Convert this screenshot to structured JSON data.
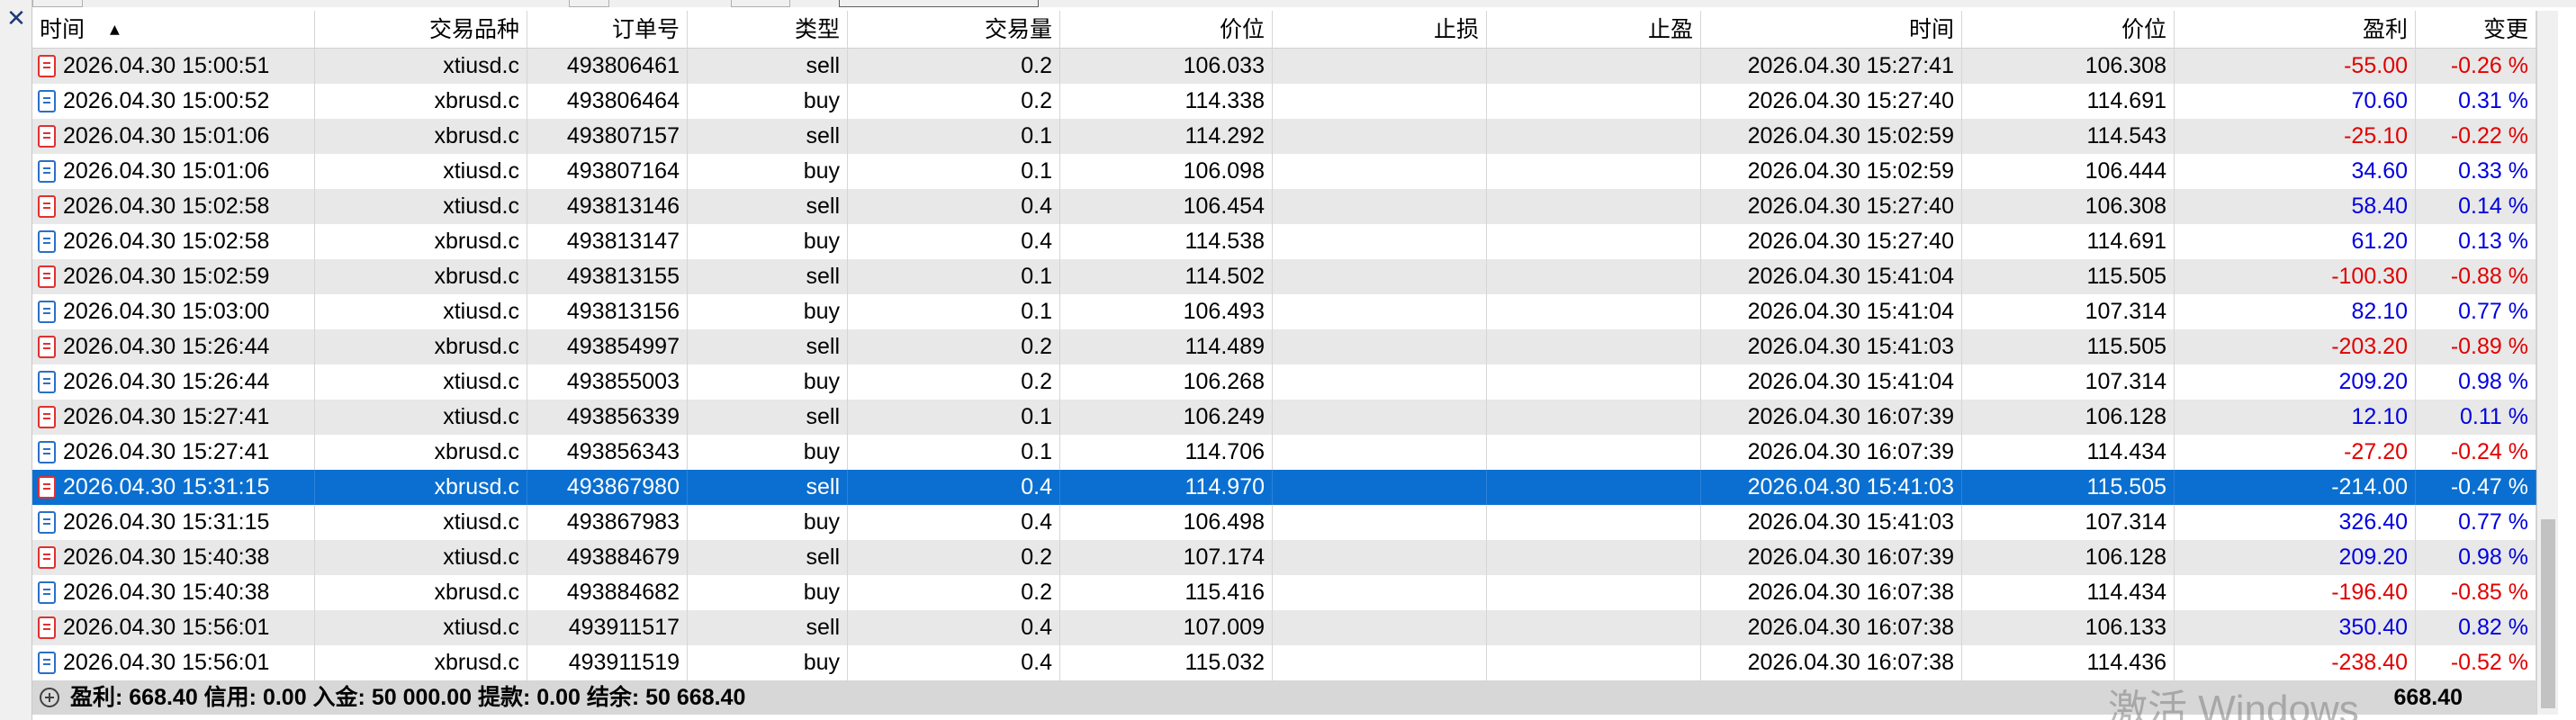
{
  "window": {
    "close_glyph": "✕"
  },
  "columns": [
    "时间",
    "交易品种",
    "订单号",
    "类型",
    "交易量",
    "价位",
    "止损",
    "止盈",
    "时间",
    "价位",
    "盈利",
    "变更"
  ],
  "rows": [
    {
      "open_time": "2026.04.30 15:00:51",
      "symbol": "xtiusd.c",
      "order": "493806461",
      "type": "sell",
      "volume": "0.2",
      "open_price": "106.033",
      "sl": "",
      "tp": "",
      "close_time": "2026.04.30 15:27:41",
      "close_price": "106.308",
      "profit": "-55.00",
      "change": "-0.26 %"
    },
    {
      "open_time": "2026.04.30 15:00:52",
      "symbol": "xbrusd.c",
      "order": "493806464",
      "type": "buy",
      "volume": "0.2",
      "open_price": "114.338",
      "sl": "",
      "tp": "",
      "close_time": "2026.04.30 15:27:40",
      "close_price": "114.691",
      "profit": "70.60",
      "change": "0.31 %"
    },
    {
      "open_time": "2026.04.30 15:01:06",
      "symbol": "xbrusd.c",
      "order": "493807157",
      "type": "sell",
      "volume": "0.1",
      "open_price": "114.292",
      "sl": "",
      "tp": "",
      "close_time": "2026.04.30 15:02:59",
      "close_price": "114.543",
      "profit": "-25.10",
      "change": "-0.22 %"
    },
    {
      "open_time": "2026.04.30 15:01:06",
      "symbol": "xtiusd.c",
      "order": "493807164",
      "type": "buy",
      "volume": "0.1",
      "open_price": "106.098",
      "sl": "",
      "tp": "",
      "close_time": "2026.04.30 15:02:59",
      "close_price": "106.444",
      "profit": "34.60",
      "change": "0.33 %"
    },
    {
      "open_time": "2026.04.30 15:02:58",
      "symbol": "xtiusd.c",
      "order": "493813146",
      "type": "sell",
      "volume": "0.4",
      "open_price": "106.454",
      "sl": "",
      "tp": "",
      "close_time": "2026.04.30 15:27:40",
      "close_price": "106.308",
      "profit": "58.40",
      "change": "0.14 %"
    },
    {
      "open_time": "2026.04.30 15:02:58",
      "symbol": "xbrusd.c",
      "order": "493813147",
      "type": "buy",
      "volume": "0.4",
      "open_price": "114.538",
      "sl": "",
      "tp": "",
      "close_time": "2026.04.30 15:27:40",
      "close_price": "114.691",
      "profit": "61.20",
      "change": "0.13 %"
    },
    {
      "open_time": "2026.04.30 15:02:59",
      "symbol": "xbrusd.c",
      "order": "493813155",
      "type": "sell",
      "volume": "0.1",
      "open_price": "114.502",
      "sl": "",
      "tp": "",
      "close_time": "2026.04.30 15:41:04",
      "close_price": "115.505",
      "profit": "-100.30",
      "change": "-0.88 %"
    },
    {
      "open_time": "2026.04.30 15:03:00",
      "symbol": "xtiusd.c",
      "order": "493813156",
      "type": "buy",
      "volume": "0.1",
      "open_price": "106.493",
      "sl": "",
      "tp": "",
      "close_time": "2026.04.30 15:41:04",
      "close_price": "107.314",
      "profit": "82.10",
      "change": "0.77 %"
    },
    {
      "open_time": "2026.04.30 15:26:44",
      "symbol": "xbrusd.c",
      "order": "493854997",
      "type": "sell",
      "volume": "0.2",
      "open_price": "114.489",
      "sl": "",
      "tp": "",
      "close_time": "2026.04.30 15:41:03",
      "close_price": "115.505",
      "profit": "-203.20",
      "change": "-0.89 %"
    },
    {
      "open_time": "2026.04.30 15:26:44",
      "symbol": "xtiusd.c",
      "order": "493855003",
      "type": "buy",
      "volume": "0.2",
      "open_price": "106.268",
      "sl": "",
      "tp": "",
      "close_time": "2026.04.30 15:41:04",
      "close_price": "107.314",
      "profit": "209.20",
      "change": "0.98 %"
    },
    {
      "open_time": "2026.04.30 15:27:41",
      "symbol": "xtiusd.c",
      "order": "493856339",
      "type": "sell",
      "volume": "0.1",
      "open_price": "106.249",
      "sl": "",
      "tp": "",
      "close_time": "2026.04.30 16:07:39",
      "close_price": "106.128",
      "profit": "12.10",
      "change": "0.11 %"
    },
    {
      "open_time": "2026.04.30 15:27:41",
      "symbol": "xbrusd.c",
      "order": "493856343",
      "type": "buy",
      "volume": "0.1",
      "open_price": "114.706",
      "sl": "",
      "tp": "",
      "close_time": "2026.04.30 16:07:39",
      "close_price": "114.434",
      "profit": "-27.20",
      "change": "-0.24 %"
    },
    {
      "open_time": "2026.04.30 15:31:15",
      "symbol": "xbrusd.c",
      "order": "493867980",
      "type": "sell",
      "volume": "0.4",
      "open_price": "114.970",
      "sl": "",
      "tp": "",
      "close_time": "2026.04.30 15:41:03",
      "close_price": "115.505",
      "profit": "-214.00",
      "change": "-0.47 %",
      "selected": true
    },
    {
      "open_time": "2026.04.30 15:31:15",
      "symbol": "xtiusd.c",
      "order": "493867983",
      "type": "buy",
      "volume": "0.4",
      "open_price": "106.498",
      "sl": "",
      "tp": "",
      "close_time": "2026.04.30 15:41:03",
      "close_price": "107.314",
      "profit": "326.40",
      "change": "0.77 %"
    },
    {
      "open_time": "2026.04.30 15:40:38",
      "symbol": "xtiusd.c",
      "order": "493884679",
      "type": "sell",
      "volume": "0.2",
      "open_price": "107.174",
      "sl": "",
      "tp": "",
      "close_time": "2026.04.30 16:07:39",
      "close_price": "106.128",
      "profit": "209.20",
      "change": "0.98 %"
    },
    {
      "open_time": "2026.04.30 15:40:38",
      "symbol": "xbrusd.c",
      "order": "493884682",
      "type": "buy",
      "volume": "0.2",
      "open_price": "115.416",
      "sl": "",
      "tp": "",
      "close_time": "2026.04.30 16:07:38",
      "close_price": "114.434",
      "profit": "-196.40",
      "change": "-0.85 %"
    },
    {
      "open_time": "2026.04.30 15:56:01",
      "symbol": "xtiusd.c",
      "order": "493911517",
      "type": "sell",
      "volume": "0.4",
      "open_price": "107.009",
      "sl": "",
      "tp": "",
      "close_time": "2026.04.30 16:07:38",
      "close_price": "106.133",
      "profit": "350.40",
      "change": "0.82 %"
    },
    {
      "open_time": "2026.04.30 15:56:01",
      "symbol": "xbrusd.c",
      "order": "493911519",
      "type": "buy",
      "volume": "0.4",
      "open_price": "115.032",
      "sl": "",
      "tp": "",
      "close_time": "2026.04.30 16:07:38",
      "close_price": "114.436",
      "profit": "-238.40",
      "change": "-0.52 %"
    }
  ],
  "footer": {
    "summary": "盈利: 668.40  信用: 0.00  入金: 50 000.00  提款: 0.00  结余: 50 668.40",
    "total_profit": "668.40"
  },
  "watermark": "激活 Windows",
  "colors": {
    "selected_row": "#0a6fd0",
    "negative": "#e00000",
    "positive": "#0000e0",
    "sell_icon": "#e03030",
    "buy_icon": "#2a6fc8"
  }
}
